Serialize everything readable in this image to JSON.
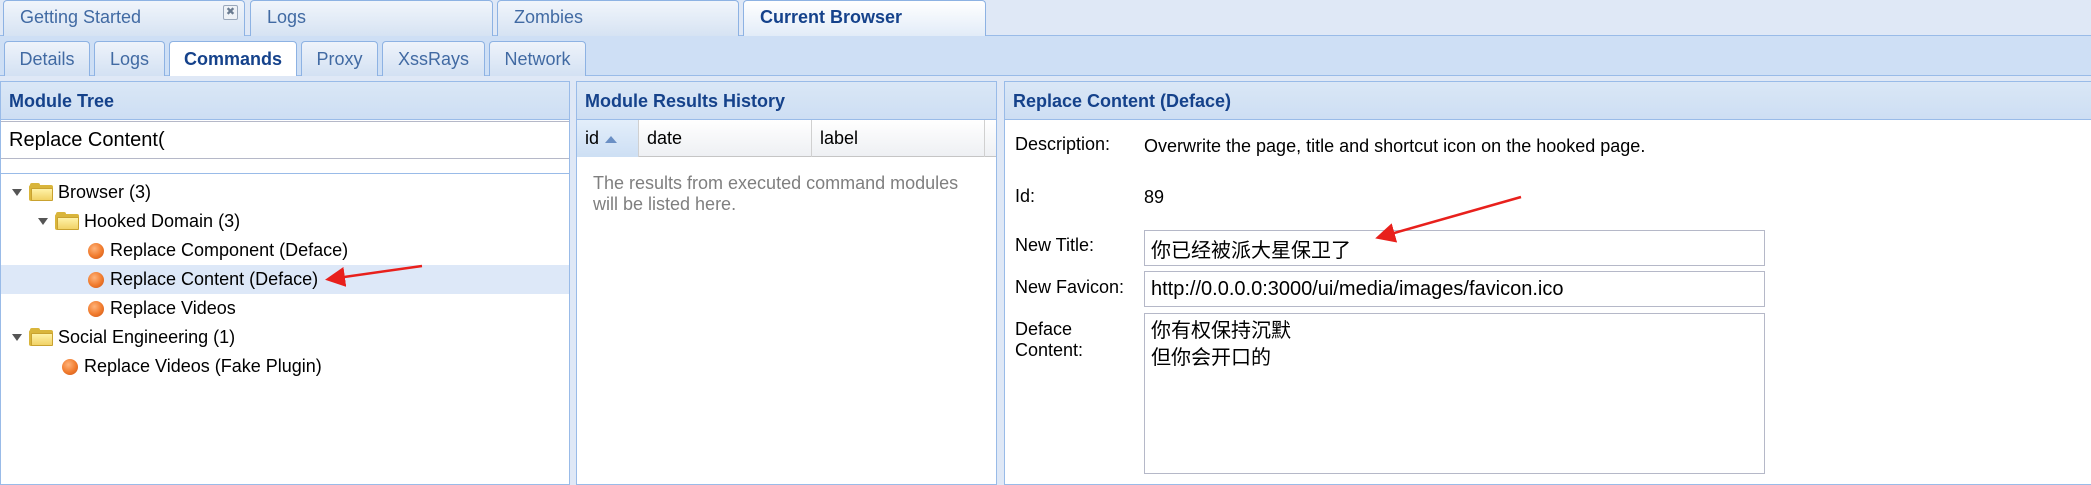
{
  "top_tabs": [
    {
      "label": "Getting Started"
    },
    {
      "label": "Logs"
    },
    {
      "label": "Zombies"
    },
    {
      "label": "Current Browser"
    }
  ],
  "sub_tabs": [
    {
      "label": "Details"
    },
    {
      "label": "Logs"
    },
    {
      "label": "Commands"
    },
    {
      "label": "Proxy"
    },
    {
      "label": "XssRays"
    },
    {
      "label": "Network"
    }
  ],
  "module_tree": {
    "title": "Module Tree",
    "search_value": "Replace Content(",
    "items": [
      {
        "label": "Browser (3)"
      },
      {
        "label": "Hooked Domain (3)"
      },
      {
        "label": "Replace Component (Deface)"
      },
      {
        "label": "Replace Content (Deface)"
      },
      {
        "label": "Replace Videos"
      },
      {
        "label": "Social Engineering (1)"
      },
      {
        "label": "Replace Videos (Fake Plugin)"
      }
    ]
  },
  "results_history": {
    "title": "Module Results History",
    "columns": [
      "id",
      "date",
      "label"
    ],
    "empty_text": "The results from executed command modules will be listed here."
  },
  "module_detail": {
    "title": "Replace Content (Deface)",
    "description_label": "Description:",
    "description": "Overwrite the page, title and shortcut icon on the hooked page.",
    "id_label": "Id:",
    "id": "89",
    "new_title_label": "New Title:",
    "new_title": "你已经被派大星保卫了",
    "new_favicon_label": "New Favicon:",
    "new_favicon": "http://0.0.0.0:3000/ui/media/images/favicon.ico",
    "deface_content_label_line1": "Deface",
    "deface_content_label_line2": "Content:",
    "deface_content": "你有权保持沉默\n但你会开口的"
  },
  "colors": {
    "annotation_arrow": "#e8201c",
    "header_text": "#15428b",
    "selection": "#dde8f8"
  }
}
